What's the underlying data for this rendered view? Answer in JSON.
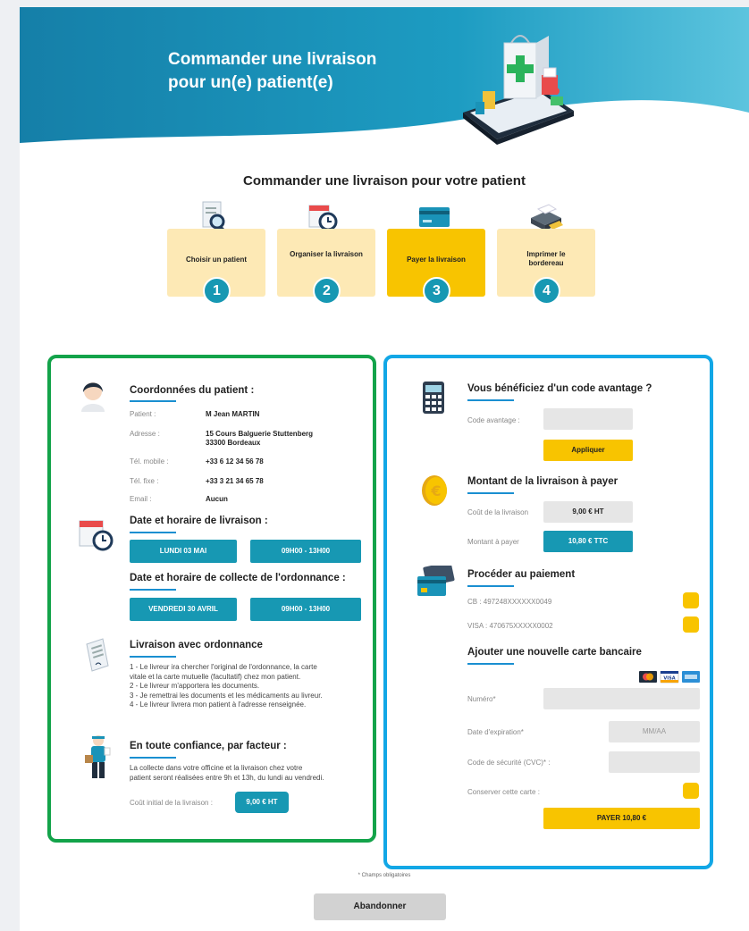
{
  "header": {
    "title_line1": "Commander une livraison",
    "title_line2": "pour un(e) patient(e)",
    "brand_color": "#1a93b8"
  },
  "section_title": "Commander une livraison pour votre patient",
  "steps": [
    {
      "label": "Choisir un patient",
      "number": "1",
      "icon": "search-document-icon"
    },
    {
      "label": "Organiser la livraison",
      "number": "2",
      "icon": "calendar-clock-icon"
    },
    {
      "label": "Payer la livraison",
      "number": "3",
      "icon": "credit-card-icon",
      "active": true
    },
    {
      "label": "Imprimer le bordereau",
      "number": "4",
      "icon": "printer-icon"
    }
  ],
  "patient": {
    "title": "Coordonnées du patient :",
    "rows": [
      {
        "key": "Patient :",
        "value": "M Jean MARTIN"
      },
      {
        "key": "Adresse :",
        "value_line1": "15 Cours Balguerie Stuttenberg",
        "value_line2": "33300 Bordeaux"
      },
      {
        "key": "Tél. mobile :",
        "value": "+33 6 12 34 56 78"
      },
      {
        "key": "Tél. fixe :",
        "value": "+33 3 21 34 65 78"
      },
      {
        "key": "Email :",
        "value": "Aucun"
      }
    ]
  },
  "delivery": {
    "title": "Date et horaire de livraison :",
    "date": "LUNDI 03 MAI",
    "time": "09H00 - 13H00",
    "collect_title": "Date et horaire de collecte de l'ordonnance :",
    "collect_date": "VENDREDI 30 AVRIL",
    "collect_time": "09H00 - 13H00"
  },
  "prescription": {
    "title": "Livraison avec ordonnance",
    "lines": [
      "1 - Le livreur ira chercher l'original de l'ordonnance, la carte",
      "vitale et la carte mutuelle (facultatif) chez mon patient.",
      "2 - Le livreur m'apportera les documents.",
      "3 - Je remettrai les documents et les médicaments au livreur.",
      "4 - Le livreur livrera mon patient à l'adresse renseignée."
    ]
  },
  "trust": {
    "title": "En toute confiance, par facteur :",
    "line1": "La collecte dans votre officine et la livraison chez votre",
    "line2": "patient seront réalisées entre 9h et 13h, du lundi au vendredi.",
    "cost_label": "Coût initial de la livraison :",
    "cost_value": "9,00 € HT"
  },
  "promo": {
    "title": "Vous bénéficiez d'un code avantage ?",
    "code_label": "Code avantage :",
    "code_value": "",
    "apply_label": "Appliquer"
  },
  "amount": {
    "title": "Montant de la livraison à payer",
    "cost_label": "Coût de la livraison",
    "cost_value": "9,00 € HT",
    "pay_label": "Montant à payer",
    "pay_value": "10,80 € TTC"
  },
  "payment": {
    "title": "Procéder au paiement",
    "cards": [
      {
        "label": "CB : 497248XXXXXX0049"
      },
      {
        "label": "VISA : 470675XXXXX0002"
      }
    ]
  },
  "new_card": {
    "title": "Ajouter une nouvelle carte bancaire",
    "number_label": "Numéro*",
    "expiry_label": "Date d'expiration*",
    "expiry_placeholder": "MM/AA",
    "cvc_label": "Code de sécurité (CVC)* :",
    "save_label": "Conserver cette carte :",
    "pay_button": "PAYER 10,80 €",
    "brand_visa": "VISA"
  },
  "footnote": "* Champs obligatoires",
  "abandon_label": "Abandonner"
}
